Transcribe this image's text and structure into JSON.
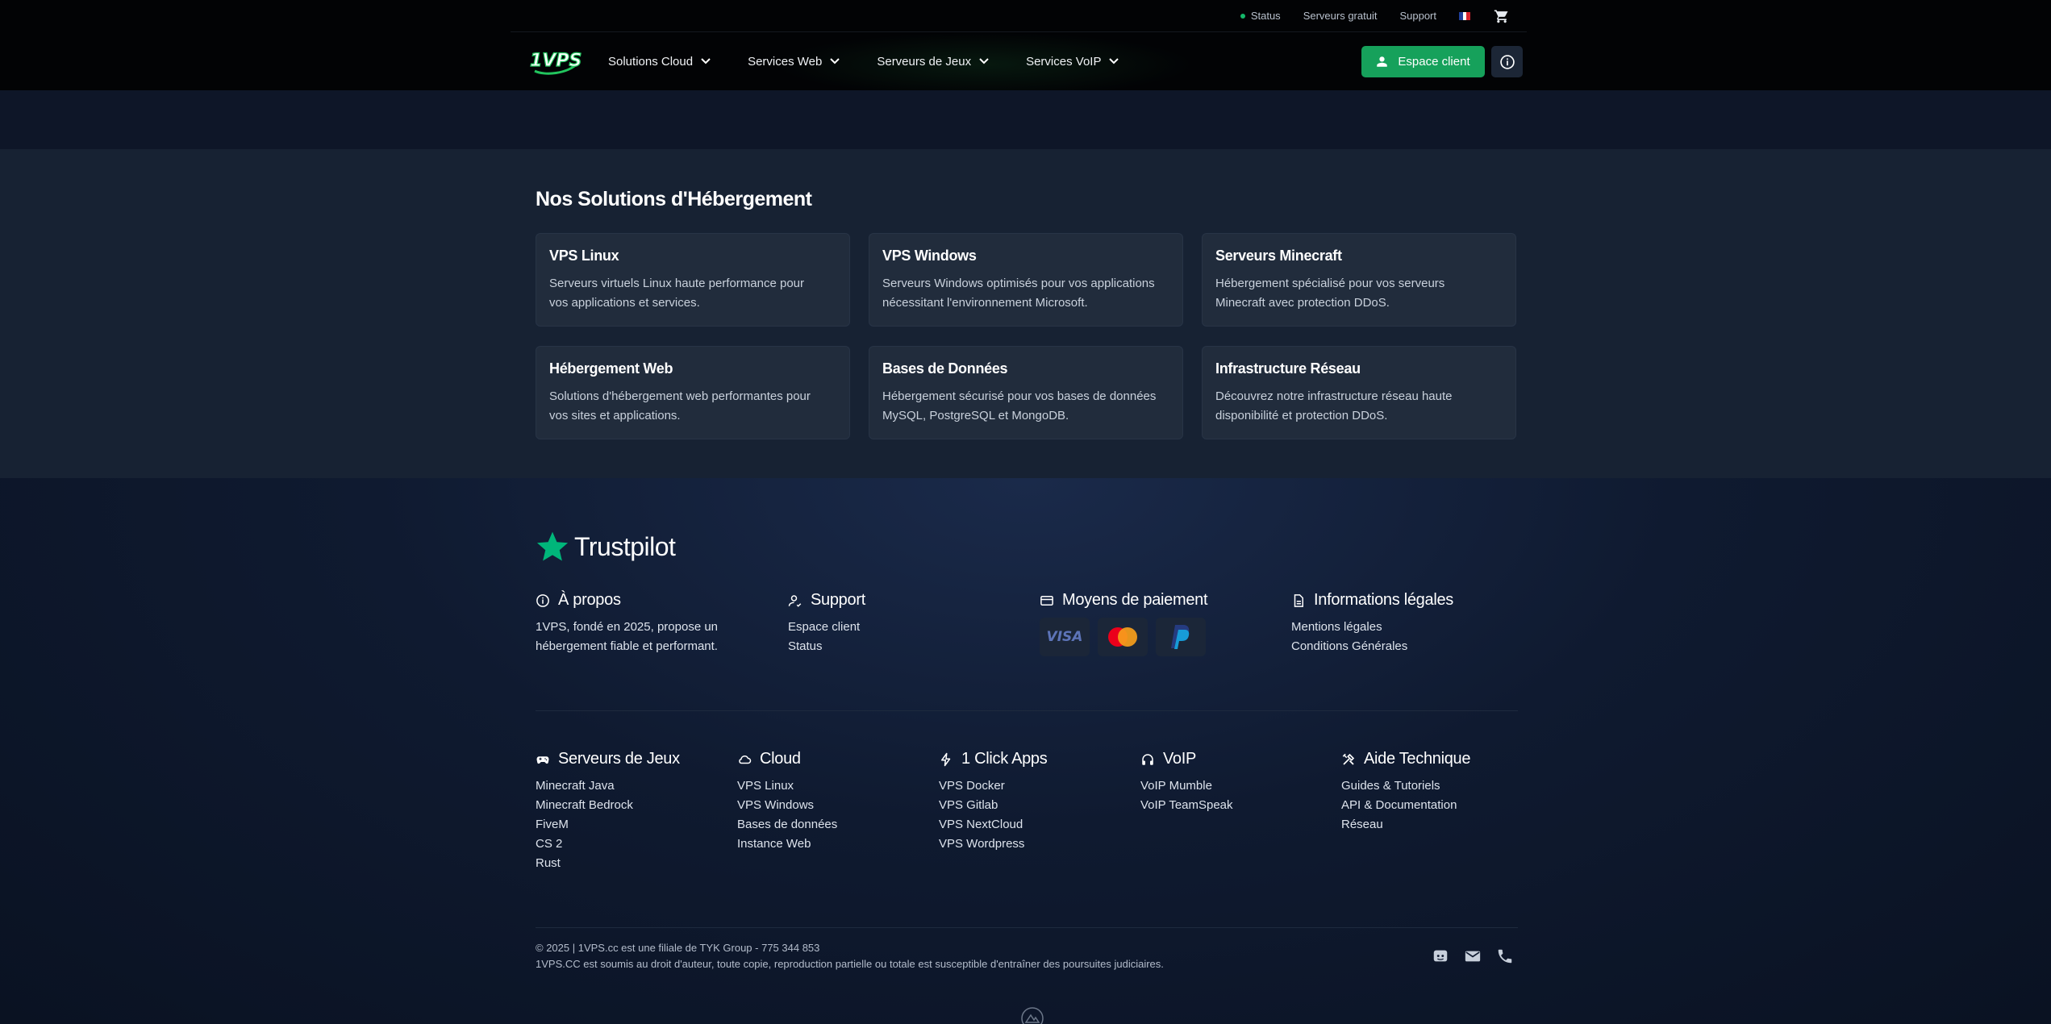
{
  "topbar": {
    "status": "Status",
    "free_servers": "Serveurs gratuit",
    "support": "Support",
    "language_flag": "fr-flag",
    "cart_icon": "cart-icon"
  },
  "nav": {
    "logo_text": "1VPS",
    "items": [
      {
        "label": "Solutions Cloud"
      },
      {
        "label": "Services Web"
      },
      {
        "label": "Serveurs de Jeux"
      },
      {
        "label": "Services VoIP"
      }
    ],
    "client_button": "Espace client",
    "accent": "#16a15b"
  },
  "solutions": {
    "title": "Nos Solutions d'Hébergement",
    "cards": [
      {
        "title": "VPS Linux",
        "desc1": "Serveurs virtuels Linux haute performance pour",
        "desc2": "vos applications et services."
      },
      {
        "title": "VPS Windows",
        "desc1": "Serveurs Windows optimisés pour vos applications",
        "desc2": "nécessitant l'environnement Microsoft."
      },
      {
        "title": "Serveurs Minecraft",
        "desc1": "Hébergement spécialisé pour vos serveurs",
        "desc2": "Minecraft avec protection DDoS."
      },
      {
        "title": "Hébergement Web",
        "desc1": "Solutions d'hébergement web performantes pour",
        "desc2": "vos sites et applications."
      },
      {
        "title": "Bases de Données",
        "desc1": "Hébergement sécurisé pour vos bases de données",
        "desc2": "MySQL, PostgreSQL et MongoDB."
      },
      {
        "title": "Infrastructure Réseau",
        "desc1": "Découvrez notre infrastructure réseau haute",
        "desc2": "disponibilité et protection DDoS."
      }
    ]
  },
  "footer": {
    "trustpilot": "Trustpilot",
    "about": {
      "title": "À propos",
      "line1": "1VPS, fondé en 2025, propose un",
      "line2": "hébergement fiable et performant."
    },
    "support": {
      "title": "Support",
      "links": [
        "Espace client",
        "Status"
      ]
    },
    "payment": {
      "title": "Moyens de paiement",
      "methods": [
        "VISA",
        "mastercard",
        "paypal"
      ]
    },
    "legal": {
      "title": "Informations légales",
      "links": [
        "Mentions légales",
        "Conditions Générales"
      ]
    },
    "games": {
      "title": "Serveurs de Jeux",
      "links": [
        "Minecraft Java",
        "Minecraft Bedrock",
        "FiveM",
        "CS 2",
        "Rust"
      ]
    },
    "cloud": {
      "title": "Cloud",
      "links": [
        "VPS Linux",
        "VPS Windows",
        "Bases de données",
        "Instance Web"
      ]
    },
    "apps": {
      "title": "1 Click Apps",
      "links": [
        "VPS Docker",
        "VPS Gitlab",
        "VPS NextCloud",
        "VPS Wordpress"
      ]
    },
    "voip": {
      "title": "VoIP",
      "links": [
        "VoIP Mumble",
        "VoIP TeamSpeak"
      ]
    },
    "help": {
      "title": "Aide Technique",
      "links": [
        "Guides & Tutoriels",
        "API & Documentation",
        "Réseau"
      ]
    },
    "copyright": "© 2025 | 1VPS.cc est une filiale de TYK Group - 775 344 853",
    "legal_notice": "1VPS.CC est soumis au droit d'auteur, toute copie, reproduction partielle ou totale est susceptible d'entraîner des poursuites judiciaires.",
    "social_icons": [
      "discord-icon",
      "mail-icon",
      "phone-icon"
    ]
  }
}
